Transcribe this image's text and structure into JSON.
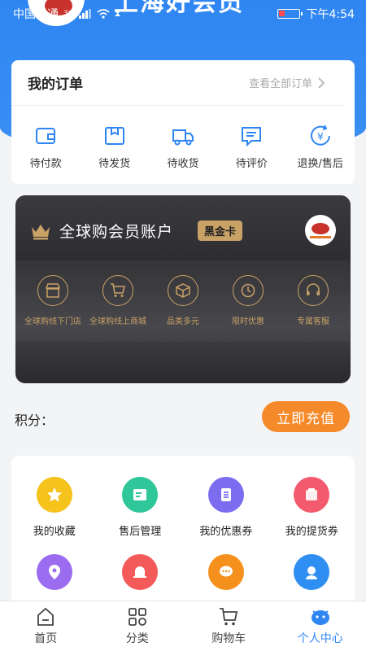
{
  "statusbar": {
    "carrier": "中国联通",
    "network": "3G",
    "time": "下午4:54"
  },
  "header": {
    "title": "上海好会员"
  },
  "orders": {
    "title": "我的订单",
    "view_all": "查看全部订单",
    "items": [
      {
        "label": "待付款",
        "icon": "wallet-icon"
      },
      {
        "label": "待发货",
        "icon": "package-icon"
      },
      {
        "label": "待收货",
        "icon": "truck-icon"
      },
      {
        "label": "待评价",
        "icon": "comment-icon"
      },
      {
        "label": "退换/售后",
        "icon": "yen-refund-icon"
      }
    ]
  },
  "member": {
    "title": "全球购会员账户",
    "badge": "黑金卡",
    "items": [
      {
        "label": "全球购线下门店",
        "icon": "store-icon"
      },
      {
        "label": "全球购线上商城",
        "icon": "cart-icon"
      },
      {
        "label": "品类多元",
        "icon": "box-icon"
      },
      {
        "label": "限时优惠",
        "icon": "clock-icon"
      },
      {
        "label": "专属客服",
        "icon": "headset-icon"
      }
    ]
  },
  "points": {
    "label": "积分：",
    "recharge": "立即充值"
  },
  "services": {
    "items": [
      {
        "label": "我的收藏",
        "icon": "star-icon",
        "color": "#f6c21c"
      },
      {
        "label": "售后管理",
        "icon": "edit-icon",
        "color": "#2fc79a"
      },
      {
        "label": "我的优惠券",
        "icon": "coupon-icon",
        "color": "#7b6cf0"
      },
      {
        "label": "我的提货券",
        "icon": "ticket-icon",
        "color": "#f45a6e"
      },
      {
        "label": "",
        "icon": "location-icon",
        "color": "#9b6cf0"
      },
      {
        "label": "",
        "icon": "bell-icon",
        "color": "#f45a5a"
      },
      {
        "label": "",
        "icon": "message-icon",
        "color": "#f5901c"
      },
      {
        "label": "",
        "icon": "support-icon",
        "color": "#2f8ef2"
      }
    ]
  },
  "nav": {
    "items": [
      {
        "label": "首页",
        "icon": "home-icon"
      },
      {
        "label": "分类",
        "icon": "category-icon"
      },
      {
        "label": "购物车",
        "icon": "cart-icon"
      },
      {
        "label": "个人中心",
        "icon": "profile-icon",
        "active": true
      }
    ]
  },
  "colors": {
    "primary": "#2f86f2",
    "accent": "#f58a2a",
    "gold": "#c9a266"
  }
}
